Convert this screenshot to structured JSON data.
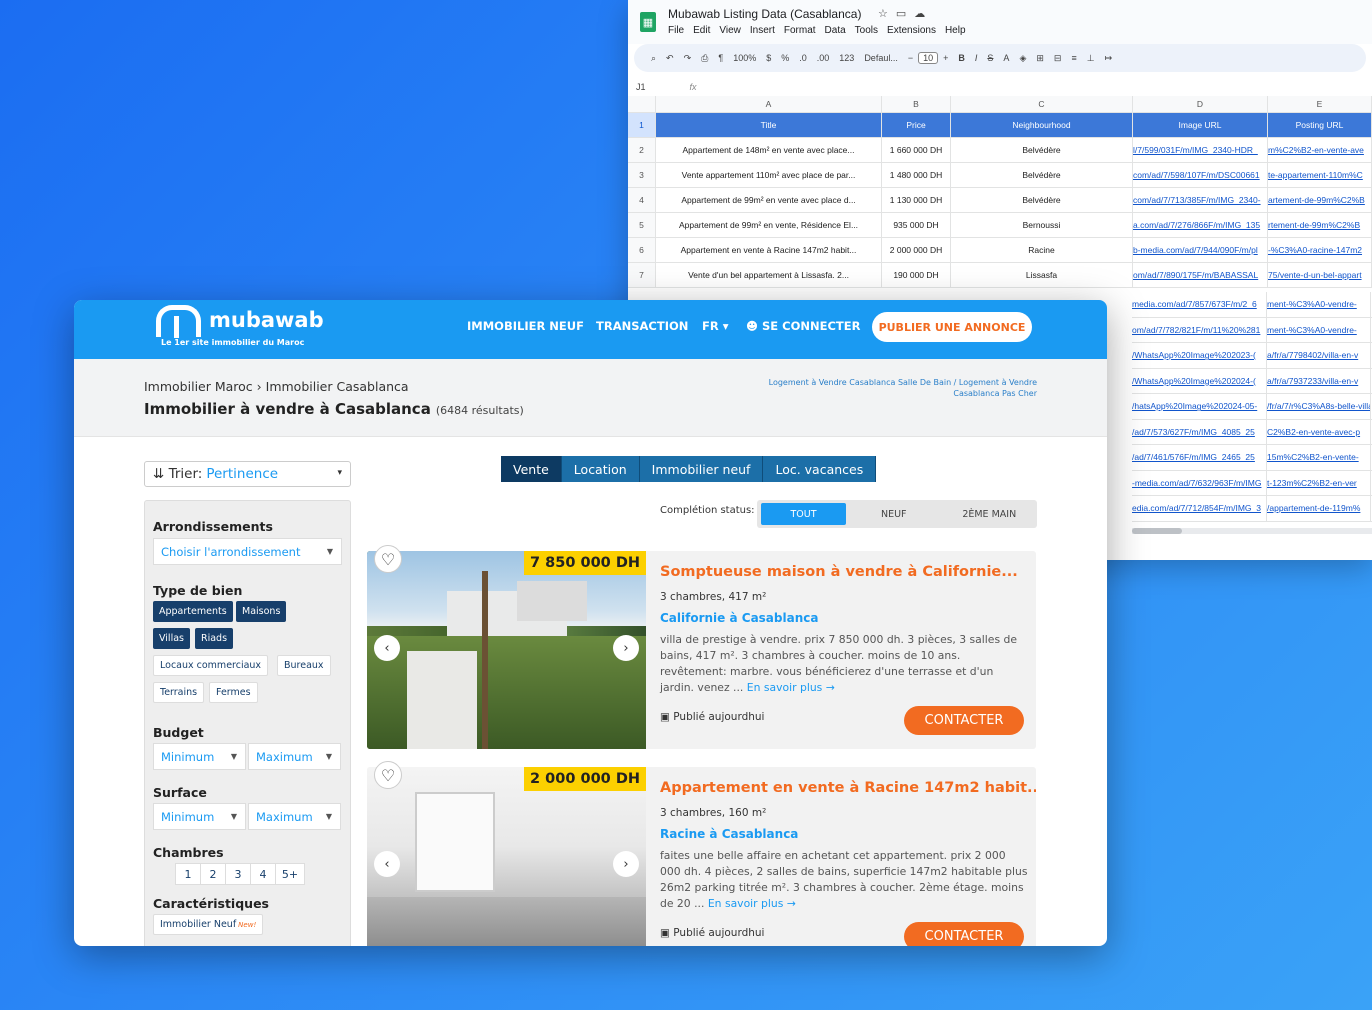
{
  "sheet": {
    "title": "Mubawab Listing Data (Casablanca)",
    "menu": [
      "File",
      "Edit",
      "View",
      "Insert",
      "Format",
      "Data",
      "Tools",
      "Extensions",
      "Help"
    ],
    "toolbar": {
      "zoom": "100%",
      "currency": "$",
      "percent": "%",
      "dec_less": ".0",
      "dec_more": ".00",
      "number_format": "123",
      "font": "Defaul...",
      "font_size": "10",
      "bold": "B",
      "italic": "I",
      "strike": "S"
    },
    "cell_ref": "J1",
    "fx": "fx",
    "col_letters": [
      "A",
      "B",
      "C",
      "D",
      "E"
    ],
    "headers": [
      "Title",
      "Price",
      "Neighbourhood",
      "Image URL",
      "Posting URL"
    ],
    "rows": [
      {
        "n": "2",
        "title": "Appartement de 148m² en vente avec place...",
        "price": "1 660 000 DH",
        "hood": "Belvédère",
        "img": "l/7/599/031F/m/IMG_2340-HDR_",
        "post": "m%C2%B2-en-vente-ave"
      },
      {
        "n": "3",
        "title": "Vente appartement 110m² avec place de par...",
        "price": "1 480 000 DH",
        "hood": "Belvédère",
        "img": "com/ad/7/598/107F/m/DSC00661",
        "post": "te-appartement-110m%C"
      },
      {
        "n": "4",
        "title": "Appartement de 99m² en vente avec place d...",
        "price": "1 130 000 DH",
        "hood": "Belvédère",
        "img": "com/ad/7/713/385F/m/IMG_2340-",
        "post": "artement-de-99m%C2%B"
      },
      {
        "n": "5",
        "title": "Appartement de 99m² en vente, Résidence El...",
        "price": "935 000 DH",
        "hood": "Bernoussi",
        "img": "a.com/ad/7/276/866F/m/IMG_135",
        "post": "rtement-de-99m%C2%B"
      },
      {
        "n": "6",
        "title": "Appartement en vente à Racine 147m2 habit...",
        "price": "2 000 000 DH",
        "hood": "Racine",
        "img": "b-media.com/ad/7/944/090F/m/pl",
        "post": "-%C3%A0-racine-147m2"
      },
      {
        "n": "7",
        "title": "Vente d'un bel appartement à Lissasfa. 2...",
        "price": "190 000 DH",
        "hood": "Lissasfa",
        "img": "om/ad/7/890/175F/m/BABASSAL",
        "post": "75/vente-d-un-bel-appart"
      }
    ],
    "url_rows": [
      {
        "img": "media.com/ad/7/857/673F/m/2_6",
        "post": "ment-%C3%A0-vendre-"
      },
      {
        "img": "om/ad/7/782/821F/m/11%20%281",
        "post": "ment-%C3%A0-vendre-"
      },
      {
        "img": "/WhatsApp%20Image%202023-(",
        "post": "a/fr/a/7798402/villa-en-v"
      },
      {
        "img": "/WhatsApp%20Image%202024-(",
        "post": "a/fr/a/7937233/villa-en-v"
      },
      {
        "img": "/hatsApp%20Image%202024-05-",
        "post": "/fr/a/7/r%C3%A8s-belle-villa"
      },
      {
        "img": "/ad/7/573/627F/m/IMG_4085_25",
        "post": "C2%B2-en-vente-avec-p"
      },
      {
        "img": "/ad/7/461/576F/m/IMG_2465_25",
        "post": "15m%C2%B2-en-vente-"
      },
      {
        "img": "-media.com/ad/7/632/963F/m/IMG",
        "post": "t-123m%C2%B2-en-ver"
      },
      {
        "img": "edia.com/ad/7/712/854F/m/IMG_3",
        "post": "/appartement-de-119m%"
      }
    ]
  },
  "site": {
    "logo": "mubawab",
    "tagline": "Le 1er site immobilier du Maroc",
    "nav": {
      "neuf": "IMMOBILIER NEUF",
      "transaction": "TRANSACTION",
      "lang": "FR ▾",
      "login": "SE CONNECTER",
      "publish": "PUBLIER UNE ANNONCE"
    },
    "breadcrumb": {
      "a": "Immobilier Maroc",
      "sep": " › ",
      "b": "Immobilier Casablanca"
    },
    "title": "Immobilier à vendre à Casablanca",
    "count": "(6484 résultats)",
    "seo_links": "Logement à Vendre Casablanca Salle De Bain / Logement à Vendre Casablanca Pas Cher",
    "sort": {
      "label": "Trier:",
      "value": "Pertinence"
    },
    "filters": {
      "arrondissements_label": "Arrondissements",
      "arrondissements_placeholder": "Choisir l'arrondissement",
      "type_label": "Type de bien",
      "types": [
        {
          "label": "Appartements",
          "on": true
        },
        {
          "label": "Maisons",
          "on": true
        },
        {
          "label": "Villas",
          "on": true
        },
        {
          "label": "Riads",
          "on": true
        },
        {
          "label": "Locaux commerciaux",
          "on": false
        },
        {
          "label": "Bureaux",
          "on": false
        },
        {
          "label": "Terrains",
          "on": false
        },
        {
          "label": "Fermes",
          "on": false
        }
      ],
      "budget_label": "Budget",
      "surface_label": "Surface",
      "min": "Minimum",
      "max": "Maximum",
      "chambres_label": "Chambres",
      "chambres": [
        "1",
        "2",
        "3",
        "4",
        "5+"
      ],
      "carac_label": "Caractéristiques",
      "carac_first": "Immobilier Neuf",
      "new_badge": "New!"
    },
    "tabs": [
      "Vente",
      "Location",
      "Immobilier neuf",
      "Loc. vacances"
    ],
    "completion_label": "Complétion status:",
    "completion": [
      "TOUT",
      "NEUF",
      "2ÈME MAIN"
    ],
    "listings": [
      {
        "price": "7 850 000 DH",
        "title": "Somptueuse maison à vendre à Californie...",
        "specs": "3 chambres, 417 m²",
        "location": "Californie à Casablanca",
        "desc": "villa de prestige à vendre. prix 7 850 000 dh. 3 pièces, 3 salles de bains, 417 m². 3 chambres à coucher. moins de 10 ans. revêtement: marbre. vous bénéficierez d'une terrasse et d'un jardin. venez ...",
        "more": "En savoir plus →",
        "date": "Publié aujourdhui",
        "cta": "CONTACTER"
      },
      {
        "price": "2 000 000 DH",
        "title": "Appartement en vente à Racine 147m2 habit...",
        "specs": "3 chambres, 160 m²",
        "location": "Racine à Casablanca",
        "desc": "faites une belle affaire en achetant cet appartement. prix 2 000 000 dh. 4 pièces, 2 salles de bains, superficie 147m2 habitable plus 26m2 parking titrée m². 3 chambres à coucher. 2ème étage. moins de 20 ...",
        "more": "En savoir plus →",
        "date": "Publié aujourdhui",
        "cta": "CONTACTER"
      }
    ]
  }
}
